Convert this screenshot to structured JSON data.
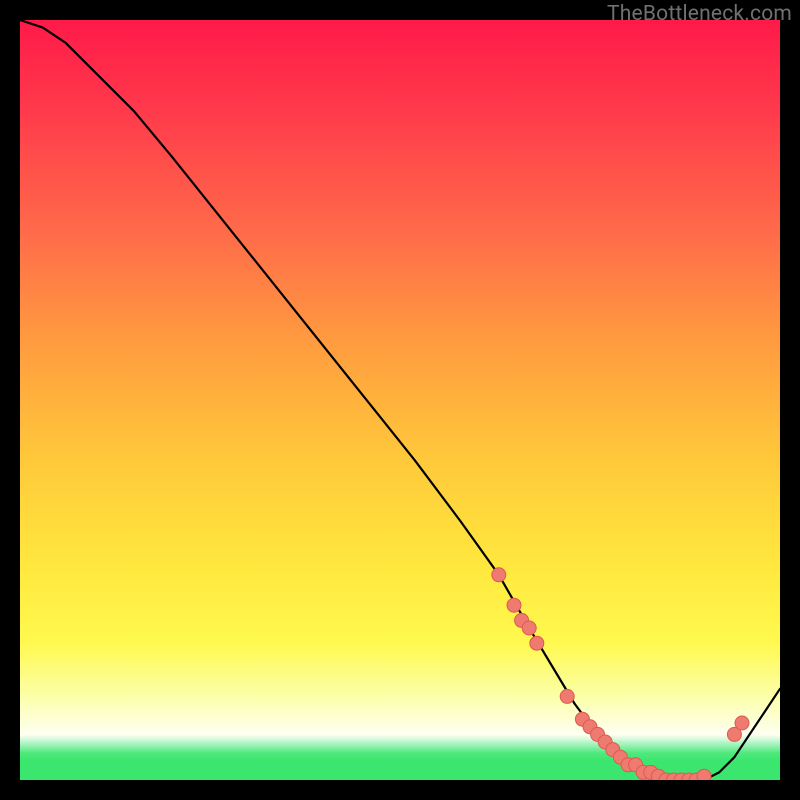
{
  "watermark": "TheBottleneck.com",
  "colors": {
    "heat_top": "#ff1a49",
    "heat_mid": "#ffe83e",
    "green": "#3ae66e",
    "dot_fill": "#ee7a70",
    "dot_stroke": "#dd5a50",
    "curve": "#000000"
  },
  "chart_data": {
    "type": "line",
    "title": "",
    "xlabel": "",
    "ylabel": "",
    "xlim": [
      0,
      100
    ],
    "ylim": [
      0,
      100
    ],
    "grid": false,
    "legend": false,
    "series": [
      {
        "name": "bottleneck-curve",
        "x": [
          0,
          3,
          6,
          10,
          15,
          20,
          28,
          36,
          44,
          52,
          58,
          63,
          67,
          70,
          73,
          76,
          79,
          82,
          85,
          88,
          90,
          92,
          94,
          96,
          98,
          100
        ],
        "y": [
          100,
          99,
          97,
          93,
          88,
          82,
          72,
          62,
          52,
          42,
          34,
          27,
          20,
          15,
          10,
          6,
          3,
          1,
          0,
          0,
          0,
          1,
          3,
          6,
          9,
          12
        ]
      }
    ],
    "markers": [
      {
        "x": 63,
        "y": 27
      },
      {
        "x": 65,
        "y": 23
      },
      {
        "x": 66,
        "y": 21
      },
      {
        "x": 67,
        "y": 20
      },
      {
        "x": 68,
        "y": 18
      },
      {
        "x": 72,
        "y": 11
      },
      {
        "x": 74,
        "y": 8
      },
      {
        "x": 75,
        "y": 7
      },
      {
        "x": 76,
        "y": 6
      },
      {
        "x": 77,
        "y": 5
      },
      {
        "x": 78,
        "y": 4
      },
      {
        "x": 79,
        "y": 3
      },
      {
        "x": 80,
        "y": 2
      },
      {
        "x": 81,
        "y": 2
      },
      {
        "x": 82,
        "y": 1
      },
      {
        "x": 83,
        "y": 1
      },
      {
        "x": 84,
        "y": 0.5
      },
      {
        "x": 85,
        "y": 0
      },
      {
        "x": 86,
        "y": 0
      },
      {
        "x": 87,
        "y": 0
      },
      {
        "x": 88,
        "y": 0
      },
      {
        "x": 89,
        "y": 0
      },
      {
        "x": 90,
        "y": 0.5
      },
      {
        "x": 94,
        "y": 6
      },
      {
        "x": 95,
        "y": 7.5
      }
    ],
    "background_gradient": {
      "direction": "vertical",
      "stops": [
        {
          "pos": 0.0,
          "color": "#ff1a49"
        },
        {
          "pos": 0.58,
          "color": "#ffc93a"
        },
        {
          "pos": 0.82,
          "color": "#fff94f"
        },
        {
          "pos": 0.95,
          "color": "#fbffa8"
        },
        {
          "pos": 0.975,
          "color": "#3ae66e"
        }
      ]
    }
  }
}
